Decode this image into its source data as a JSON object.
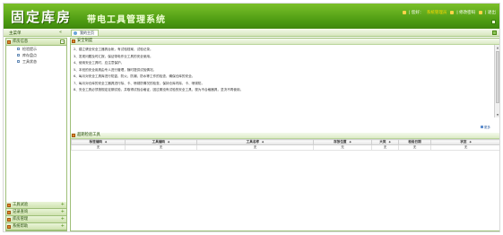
{
  "app": {
    "title_main": "固定库房",
    "title_sub": "带电工具管理系统"
  },
  "header_links": {
    "welcome": "| 您好：",
    "user": "系统管理员",
    "change_password": "| 修改密码",
    "logout": "| 退出"
  },
  "menu": {
    "label": "主菜单",
    "collapse_glyph": "«"
  },
  "tab": {
    "label": "我的主页"
  },
  "sidebar": {
    "open_group": {
      "label": "库房信息",
      "toggle": "−",
      "items": [
        {
          "label": "检验提示"
        },
        {
          "label": "库存盘点"
        },
        {
          "label": "工具状态"
        }
      ]
    },
    "groups": [
      {
        "label": "工具试验",
        "toggle": "+"
      },
      {
        "label": "记录查询",
        "toggle": "+"
      },
      {
        "label": "库房管理",
        "toggle": "+"
      },
      {
        "label": "系统帮助",
        "toggle": "+"
      }
    ]
  },
  "notice": {
    "title": "安全制度",
    "lines": [
      "2、建立健全安全工器具台帐，有试验档案、试验记录。",
      "3、发现问题及时汇报，保证带电作业工具的安全使用。",
      "4、使用安全工具时，应注意保护。",
      "5、本班的安全用具由专人进行管理，随时提供试验情况。",
      "6、每月对安全工具库进行防盗、防火、防潮、防水等工作的检查，确保仓库的安全。",
      "7、每月对仓库的安全工器具进行除、卡、喷锈防情况的检查，保持仓库内除、卡、喷锈防。",
      "8、安全工具必须按规定定期试验，并取得试验合格证，因过期没有试验的安全工具，视为不合格器具，坚决不再使用。"
    ],
    "more_label": "更多"
  },
  "expiring": {
    "title": "超期检验工具",
    "columns": [
      "标签编码",
      "工具编码",
      "工具名称",
      "存放位置",
      "大类",
      "检验日期",
      "状态"
    ],
    "sort_glyph": "◆",
    "rows": [
      [
        "无",
        "无",
        "无",
        "无",
        "无",
        "无",
        "无"
      ]
    ]
  }
}
